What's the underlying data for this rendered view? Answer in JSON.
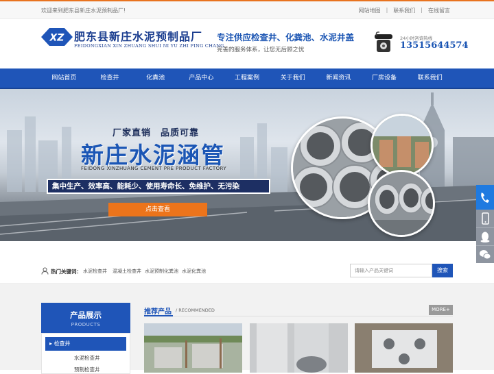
{
  "topbar": {
    "welcome": "欢迎来到肥东县新庄水泥预制品厂!",
    "links": [
      "网站地图",
      "联系我们",
      "在线留言"
    ],
    "separator": "|"
  },
  "header": {
    "logo_letters": "XZ",
    "company_name": "肥东县新庄水泥预制品厂",
    "company_pinyin": "FEIDONGXIAN XIN ZHUANG SHUI NI YU ZHI PING CHANG",
    "slogan_main": "专注供应检查井、化粪池、水泥井盖",
    "slogan_sub": "完善的服务体系，让您无后顾之忧",
    "hotline_label": "24小时咨询热线",
    "hotline_number": "13515644574"
  },
  "nav": {
    "items": [
      "网站首页",
      "检查井",
      "化粪池",
      "产品中心",
      "工程案例",
      "关于我们",
      "新闻资讯",
      "厂房设备",
      "联系我们"
    ]
  },
  "banner": {
    "heading_small": "厂家直销　品质可靠",
    "heading_large": "新庄水泥涵管",
    "heading_en": "FEIDONG XINZHUANG CEMENT PRE PRODUCT FACTORY",
    "features": "集中生产、效率高、能耗少、使用寿命长、免维护、无污染",
    "cta": "点击查看",
    "slides": 3,
    "active_slide": 2
  },
  "keywords": {
    "label": "热门关键词：",
    "items": [
      "水泥检查井",
      "混凝土检查井",
      "水泥预制化粪池",
      "水泥化粪池"
    ]
  },
  "search": {
    "placeholder": "请输入产品关键词",
    "button": "搜索"
  },
  "sidebar": {
    "title": "产品展示",
    "title_en": "PRODUCTS",
    "category": "检查井",
    "subitems": [
      "水泥检查井",
      "预制检查井"
    ]
  },
  "recommended": {
    "title": "推荐产品",
    "title_en": "/ RECOMMENDED",
    "more": "MORE+"
  },
  "colors": {
    "brand_blue": "#1f55b8",
    "accent_orange": "#ec741b",
    "topbar_orange": "#e8731f"
  },
  "float_icons": [
    "phone-icon",
    "mobile-icon",
    "qq-icon",
    "wechat-icon"
  ]
}
